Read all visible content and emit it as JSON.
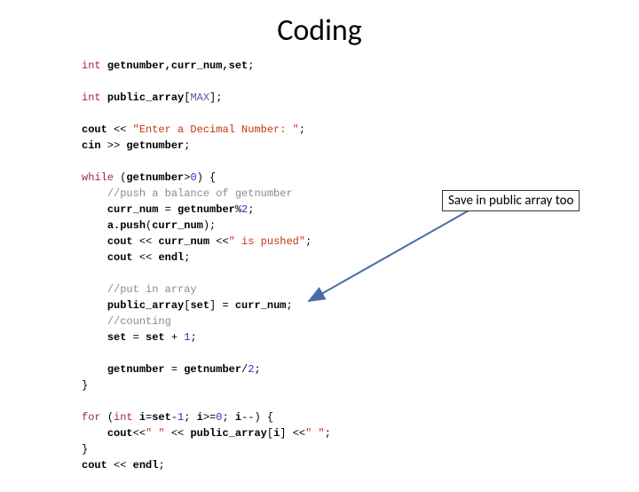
{
  "title": "Coding",
  "annotation": "Save in public array too",
  "code": {
    "l1_int": "int",
    "l1_vars": "getnumber,curr_num,set",
    "l3_int": "int",
    "l3_arr": "public_array",
    "l3_max": "MAX",
    "l5_cout": "cout",
    "l5_op": "<<",
    "l5_str": "\"Enter a Decimal Number: \"",
    "l6_cin": "cin",
    "l6_op": ">>",
    "l6_var": "getnumber",
    "l8_while": "while",
    "l8_var": "getnumber",
    "l8_gt": ">",
    "l8_zero": "0",
    "l9_cm": "//push a balance of getnumber",
    "l10_lhs": "curr_num",
    "l10_eq": "=",
    "l10_rhs": "getnumber",
    "l10_mod": "%",
    "l10_two": "2",
    "l11_a": "a.push",
    "l11_arg": "curr_num",
    "l12_cout": "cout",
    "l12_op1": "<<",
    "l12_var": "curr_num",
    "l12_op2": "<<",
    "l12_str": "\" is pushed\"",
    "l13_cout": "cout",
    "l13_op": "<<",
    "l13_endl": "endl",
    "l15_cm": "//put in array",
    "l16_arr": "public_array",
    "l16_idx": "set",
    "l16_eq": "=",
    "l16_rhs": "curr_num",
    "l17_cm": "//counting",
    "l18_set": "set",
    "l18_eq": "=",
    "l18_set2": "set",
    "l18_plus": "+",
    "l18_one": "1",
    "l20_lhs": "getnumber",
    "l20_eq": "=",
    "l20_rhs": "getnumber",
    "l20_div": "/",
    "l20_two": "2",
    "l23_for": "for",
    "l23_int": "int",
    "l23_i": "i",
    "l23_eq": "=",
    "l23_set": "set",
    "l23_minus": "-",
    "l23_one": "1",
    "l23_sc1": ";",
    "l23_i2": "i",
    "l23_ge": ">=",
    "l23_zero": "0",
    "l23_sc2": ";",
    "l23_i3": "i",
    "l23_dec": "--",
    "l24_cout": "cout",
    "l24_op1": "<<",
    "l24_sp": "\" \"",
    "l24_op2": "<<",
    "l24_arr": "public_array",
    "l24_i": "i",
    "l24_op3": "<<",
    "l24_sp2": "\" \"",
    "l26_cout": "cout",
    "l26_op": "<<",
    "l26_endl": "endl"
  }
}
